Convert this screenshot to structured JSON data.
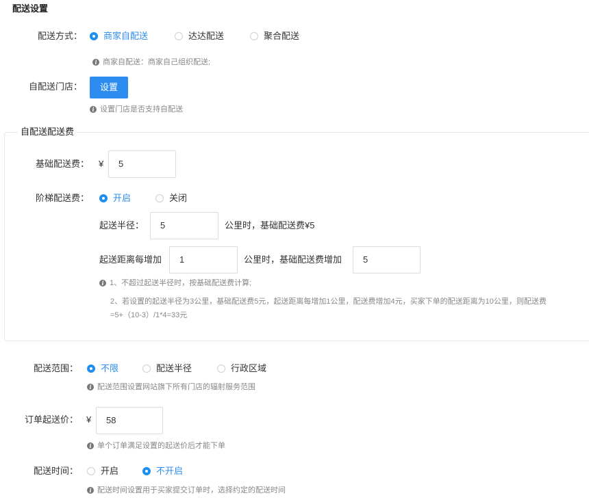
{
  "page": {
    "title": "配送设置"
  },
  "delivery_method": {
    "label": "配送方式：",
    "options": [
      {
        "label": "商家自配送",
        "checked": true
      },
      {
        "label": "达达配送",
        "checked": false
      },
      {
        "label": "聚合配送",
        "checked": false
      }
    ],
    "hint": "商家自配送：商家自己组织配送;"
  },
  "self_store": {
    "label": "自配送门店：",
    "button": "设置",
    "hint": "设置门店是否支持自配送"
  },
  "fee_section": {
    "legend": "自配送配送费",
    "base_fee": {
      "label": "基础配送费：",
      "currency": "¥",
      "value": "5"
    },
    "tiered_fee": {
      "label": "阶梯配送费：",
      "options": [
        {
          "label": "开启",
          "checked": true
        },
        {
          "label": "关闭",
          "checked": false
        }
      ],
      "radius_label": "起送半径：",
      "radius_value": "5",
      "radius_suffix": "公里时，基础配送费¥5",
      "increment_label": "起送距离每增加",
      "increment_value": "1",
      "increment_mid": "公里时，基础配送费增加",
      "increment_fee_value": "5",
      "note1": "1、不超过起送半径时，按基础配送费计算;",
      "note2": "2、若设置的起送半径为3公里，基础配送费5元，起送距离每增加1公里，配送费增加4元，买家下单的配送距离为10公里，则配送费",
      "note3": "=5+（10-3）/1*4=33元"
    }
  },
  "delivery_range": {
    "label": "配送范围：",
    "options": [
      {
        "label": "不限",
        "checked": true
      },
      {
        "label": "配送半径",
        "checked": false
      },
      {
        "label": "行政区域",
        "checked": false
      }
    ],
    "hint": "配送范围设置网站旗下所有门店的辐射服务范围"
  },
  "min_order": {
    "label": "订单起送价：",
    "currency": "¥",
    "value": "58",
    "hint": "单个订单满足设置的起送价后才能下单"
  },
  "delivery_time": {
    "label": "配送时间：",
    "options": [
      {
        "label": "开启",
        "checked": false
      },
      {
        "label": "不开启",
        "checked": true
      }
    ],
    "hint": "配送时间设置用于买家提交订单时，选择约定的配送时间"
  },
  "colors": {
    "accent": "#2d8cf0",
    "hint": "#888888",
    "border": "#dcdcdc"
  },
  "icons": {
    "hint": "info-icon"
  }
}
